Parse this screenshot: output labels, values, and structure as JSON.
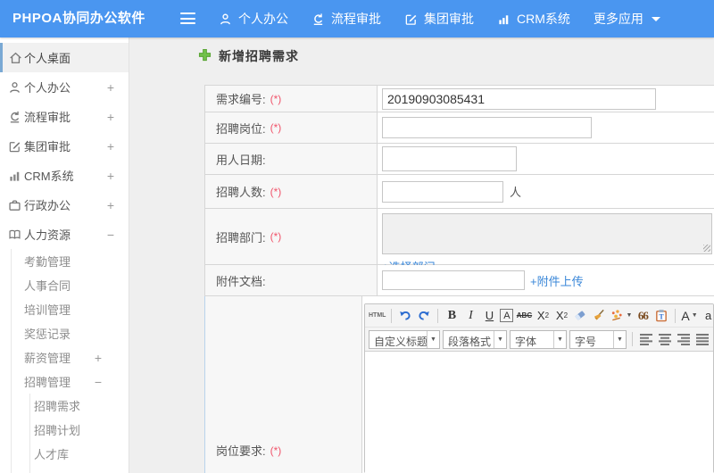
{
  "colors": {
    "header_blue": "#4a96f0",
    "link_blue": "#3a87d8",
    "required_red": "#f0536a",
    "plus_green": "#72c14a"
  },
  "header": {
    "brand": "PHPOA协同办公软件",
    "nav": [
      {
        "label": "个人办公",
        "icon": "user-icon"
      },
      {
        "label": "流程审批",
        "icon": "workflow-icon"
      },
      {
        "label": "集团审批",
        "icon": "edit-square-icon"
      },
      {
        "label": "CRM系统",
        "icon": "bar-chart-icon"
      },
      {
        "label": "更多应用",
        "icon": "caret-down-icon"
      }
    ]
  },
  "sidebar": {
    "items": [
      {
        "label": "个人桌面",
        "icon": "home-icon",
        "level": 1,
        "active": true
      },
      {
        "label": "个人办公",
        "icon": "user-icon",
        "level": 1,
        "toggle": "+"
      },
      {
        "label": "流程审批",
        "icon": "workflow-icon",
        "level": 1,
        "toggle": "+"
      },
      {
        "label": "集团审批",
        "icon": "edit-square-icon",
        "level": 1,
        "toggle": "+"
      },
      {
        "label": "CRM系统",
        "icon": "bar-chart-icon",
        "level": 1,
        "toggle": "+"
      },
      {
        "label": "行政办公",
        "icon": "briefcase-icon",
        "level": 1,
        "toggle": "+"
      },
      {
        "label": "人力资源",
        "icon": "book-icon",
        "level": 1,
        "toggle": "−"
      },
      {
        "label": "考勤管理",
        "level": 2
      },
      {
        "label": "人事合同",
        "level": 2
      },
      {
        "label": "培训管理",
        "level": 2
      },
      {
        "label": "奖惩记录",
        "level": 2
      },
      {
        "label": "薪资管理",
        "level": 2,
        "toggle": "+"
      },
      {
        "label": "招聘管理",
        "level": 2,
        "toggle": "−"
      },
      {
        "label": "招聘需求",
        "level": 3
      },
      {
        "label": "招聘计划",
        "level": 3
      },
      {
        "label": "人才库",
        "level": 3
      }
    ]
  },
  "main": {
    "title": "新增招聘需求",
    "form": {
      "required_mark": "(*)",
      "rows": [
        {
          "label": "需求编号:",
          "required": true,
          "value": "20190903085431"
        },
        {
          "label": "招聘岗位:",
          "required": true,
          "value": ""
        },
        {
          "label": "用人日期:",
          "required": false,
          "value": ""
        },
        {
          "label": "招聘人数:",
          "required": true,
          "value": "",
          "suffix": "人"
        },
        {
          "label": "招聘部门:",
          "required": true,
          "value": "",
          "link": "+选择部门"
        },
        {
          "label": "附件文档:",
          "required": false,
          "value": "",
          "link": "+附件上传"
        },
        {
          "label": "岗位要求:",
          "required": true
        }
      ]
    },
    "editor": {
      "toolbar_row1": {
        "source": "HTML",
        "bold": "B",
        "italic": "I",
        "underline": "U",
        "font_box": "A",
        "strike": "ABC",
        "sup_base": "X",
        "sup_exp": "2",
        "sub_base": "X",
        "sub_exp": "2",
        "quote": "66",
        "font_color": "A",
        "back_color": "a"
      },
      "toolbar_row2": {
        "selects": [
          {
            "label": "自定义标题"
          },
          {
            "label": "段落格式"
          },
          {
            "label": "字体"
          },
          {
            "label": "字号"
          }
        ]
      }
    }
  }
}
